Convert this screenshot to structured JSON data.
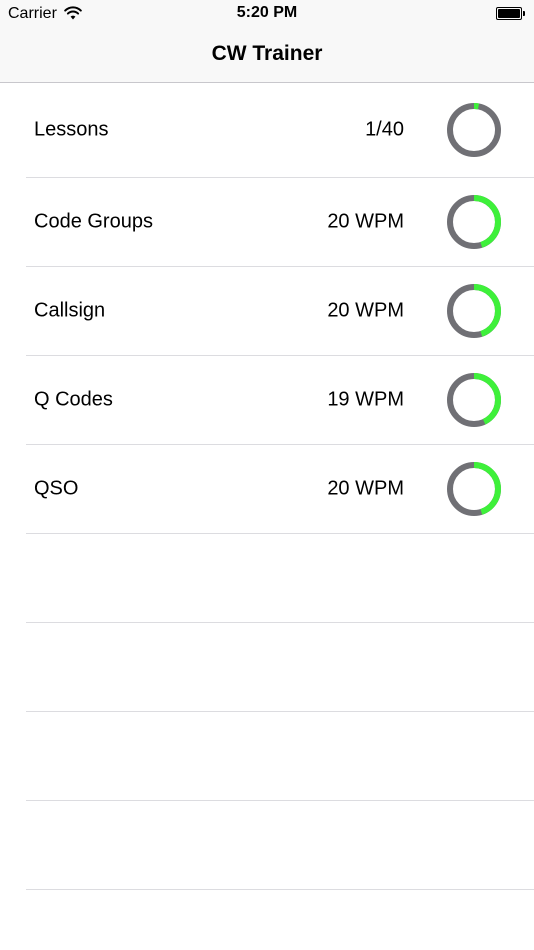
{
  "status_bar": {
    "carrier": "Carrier",
    "time": "5:20 PM",
    "wifi_icon": "wifi-icon",
    "battery_icon": "battery-icon",
    "battery_level": 1.0
  },
  "nav": {
    "title": "CW Trainer"
  },
  "colors": {
    "ring_track": "#707075",
    "ring_progress": "#3ef03a"
  },
  "rows": [
    {
      "label": "Lessons",
      "value": "1/40",
      "progress": 0.03
    },
    {
      "label": "Code Groups",
      "value": "20 WPM",
      "progress": 0.45
    },
    {
      "label": "Callsign",
      "value": "20 WPM",
      "progress": 0.45
    },
    {
      "label": "Q Codes",
      "value": "19 WPM",
      "progress": 0.43
    },
    {
      "label": "QSO",
      "value": "20 WPM",
      "progress": 0.45
    }
  ]
}
